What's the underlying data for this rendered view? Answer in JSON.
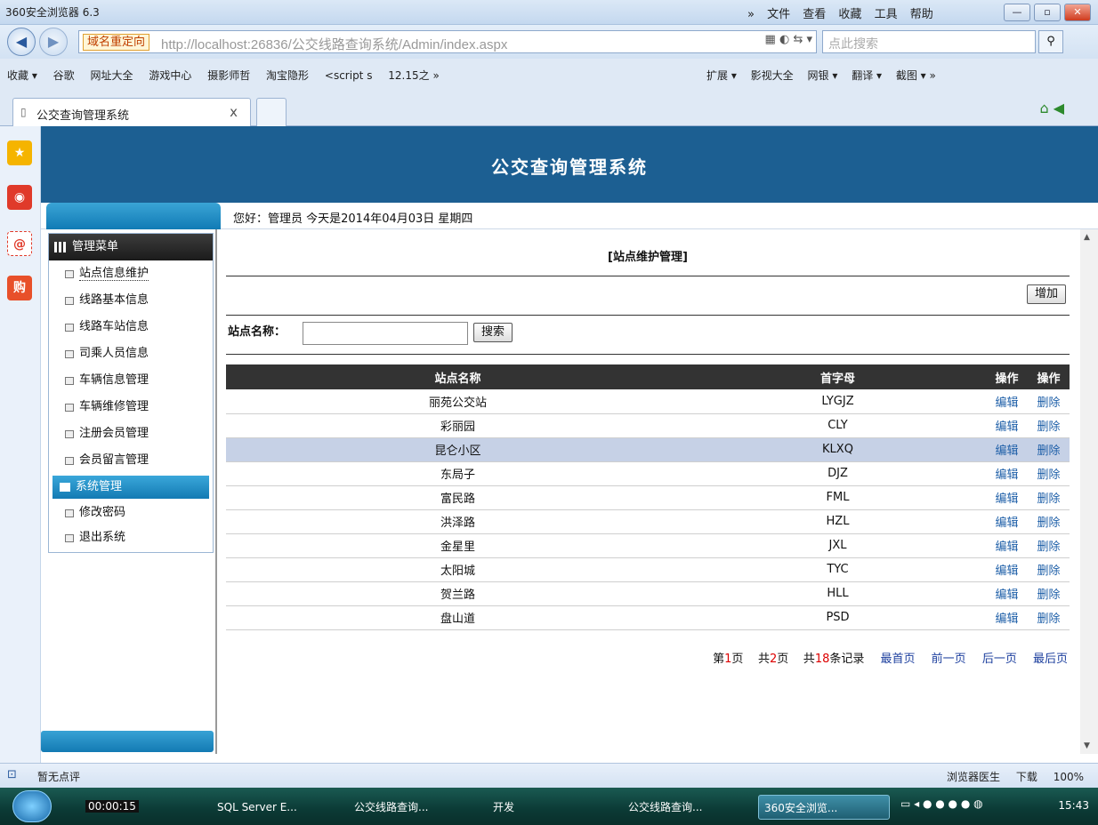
{
  "browser": {
    "title": "360安全浏览器 6.3",
    "menus": [
      "»",
      "文件",
      "查看",
      "收藏",
      "工具",
      "帮助"
    ],
    "redirect_label": "域名重定向",
    "url": "http://localhost:26836/公交线路查询系统/Admin/index.aspx",
    "search_placeholder": "点此搜索",
    "bookmarks": [
      "收藏 ▾",
      "谷歌",
      "网址大全",
      "游戏中心",
      "摄影师哲",
      "淘宝隐形",
      "<script s",
      "12.15之 »"
    ],
    "bookmarks_right": [
      "扩展 ▾",
      "影视大全",
      "网银 ▾",
      "翻译 ▾",
      "截图 ▾ »"
    ],
    "tab_label": "公交查询管理系统",
    "tab_close": "x",
    "status_left": "暂无点评",
    "status_right": [
      "浏览器医生",
      "下载",
      "100%"
    ]
  },
  "app": {
    "title": "公交查询管理系统",
    "welcome": "您好：管理员   今天是2014年04月03日   星期四",
    "menu_header": "管理菜单",
    "menu_items": [
      "站点信息维护",
      "线路基本信息",
      "线路车站信息",
      "司乘人员信息",
      "车辆信息管理",
      "车辆维修管理",
      "注册会员管理",
      "会员留言管理"
    ],
    "system_header": "系统管理",
    "system_items": [
      "修改密码",
      "退出系统"
    ]
  },
  "content": {
    "title": "[站点维护管理]",
    "add_label": "增加",
    "search_label": "站点名称：",
    "search_value": "",
    "search_button": "搜索",
    "columns": [
      "站点名称",
      "首字母",
      "操作",
      "操作"
    ],
    "rows": [
      {
        "name": "丽苑公交站",
        "code": "LYGJZ"
      },
      {
        "name": "彩丽园",
        "code": "CLY"
      },
      {
        "name": "昆仑小区",
        "code": "KLXQ"
      },
      {
        "name": "东局子",
        "code": "DJZ"
      },
      {
        "name": "富民路",
        "code": "FML"
      },
      {
        "name": "洪泽路",
        "code": "HZL"
      },
      {
        "name": "金星里",
        "code": "JXL"
      },
      {
        "name": "太阳城",
        "code": "TYC"
      },
      {
        "name": "贺兰路",
        "code": "HLL"
      },
      {
        "name": "盘山道",
        "code": "PSD"
      }
    ],
    "edit_label": "编辑",
    "delete_label": "删除",
    "pager": {
      "page_prefix": "第",
      "page": "1",
      "page_suffix": "页",
      "total_prefix": "共",
      "total_pages": "2",
      "total_suffix": "页",
      "records_prefix": "共",
      "records": "18",
      "records_suffix": "条记录",
      "first": "最首页",
      "prev": "前一页",
      "next": "后一页",
      "last": "最后页"
    }
  },
  "taskbar": {
    "timer": "00:00:15",
    "tasks": [
      "SQL Server E...",
      "公交线路查询...",
      "开发",
      "公交线路查询...",
      "360安全浏览..."
    ],
    "clock": "15:43"
  },
  "colors": {
    "header_blue": "#1c5f92",
    "menu_blue": "#137ab3",
    "row_highlight": "#c6d1e6",
    "link": "#1e5fa8"
  }
}
